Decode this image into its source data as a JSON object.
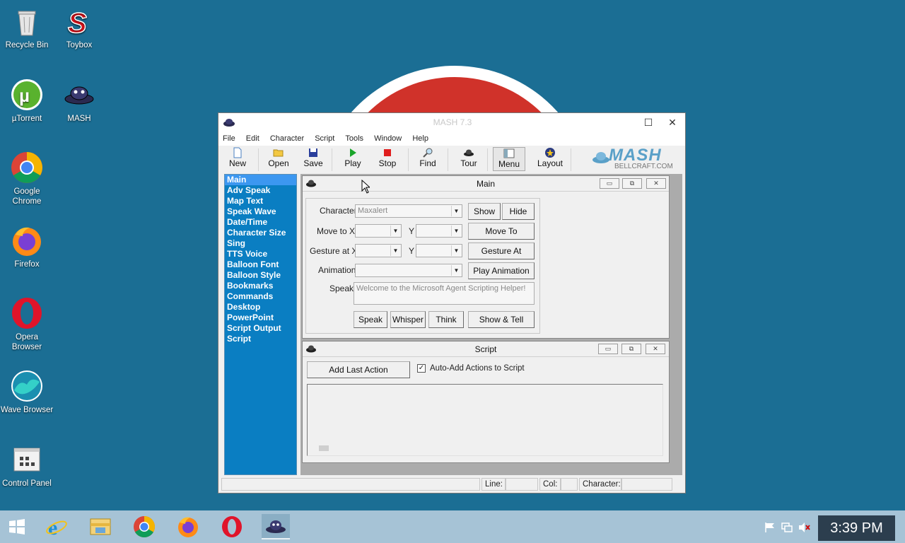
{
  "desktop": {
    "icons": [
      {
        "label": "Recycle Bin",
        "icon": "recycle-bin-icon"
      },
      {
        "label": "Toybox",
        "icon": "toybox-icon"
      },
      {
        "label": "µTorrent",
        "icon": "utorrent-icon"
      },
      {
        "label": "MASH",
        "icon": "mash-icon"
      },
      {
        "label": "Google Chrome",
        "icon": "chrome-icon"
      },
      {
        "label": "Firefox",
        "icon": "firefox-icon"
      },
      {
        "label": "Opera Browser",
        "icon": "opera-icon"
      },
      {
        "label": "Wave Browser",
        "icon": "wave-browser-icon"
      },
      {
        "label": "Control Panel",
        "icon": "control-panel-icon"
      }
    ]
  },
  "window": {
    "title": "MASH 7.3",
    "menu": [
      "File",
      "Edit",
      "Character",
      "Script",
      "Tools",
      "Window",
      "Help"
    ],
    "toolbar": {
      "new": "New",
      "open": "Open",
      "save": "Save",
      "play": "Play",
      "stop": "Stop",
      "find": "Find",
      "tour": "Tour",
      "menu": "Menu",
      "layout": "Layout"
    },
    "logo": {
      "text": "MASH",
      "subtext": "BELLCRAFT.COM"
    },
    "sidebar": [
      "Main",
      "Adv Speak",
      "Map Text",
      "Speak Wave",
      "Date/Time",
      "Character Size",
      "Sing",
      "TTS Voice",
      "Balloon Font",
      "Balloon Style",
      "Bookmarks",
      "Commands",
      "Desktop",
      "PowerPoint",
      "Script Output",
      "Script"
    ],
    "main_panel": {
      "title": "Main",
      "character_label": "Character",
      "character_value": "Maxalert",
      "show": "Show",
      "hide": "Hide",
      "move_to_x_label": "Move to X",
      "y_label": "Y",
      "move_to": "Move To",
      "gesture_at_x_label": "Gesture at X",
      "gesture_at": "Gesture At",
      "animation_label": "Animation",
      "play_animation": "Play Animation",
      "speak_label": "Speak",
      "speak_text": "Welcome to the Microsoft Agent Scripting Helper!",
      "speak_btn": "Speak",
      "whisper_btn": "Whisper",
      "think_btn": "Think",
      "show_tell_btn": "Show & Tell"
    },
    "script_panel": {
      "title": "Script",
      "add_last_action": "Add Last Action",
      "auto_add": "Auto-Add Actions to Script",
      "auto_add_checked": true
    },
    "status": {
      "line": "Line:",
      "col": "Col:",
      "character": "Character:"
    }
  },
  "taskbar": {
    "apps": [
      "start-icon",
      "internet-explorer-icon",
      "file-explorer-icon",
      "chrome-icon",
      "firefox-icon",
      "opera-icon",
      "mash-icon"
    ],
    "time": "3:39 PM"
  }
}
